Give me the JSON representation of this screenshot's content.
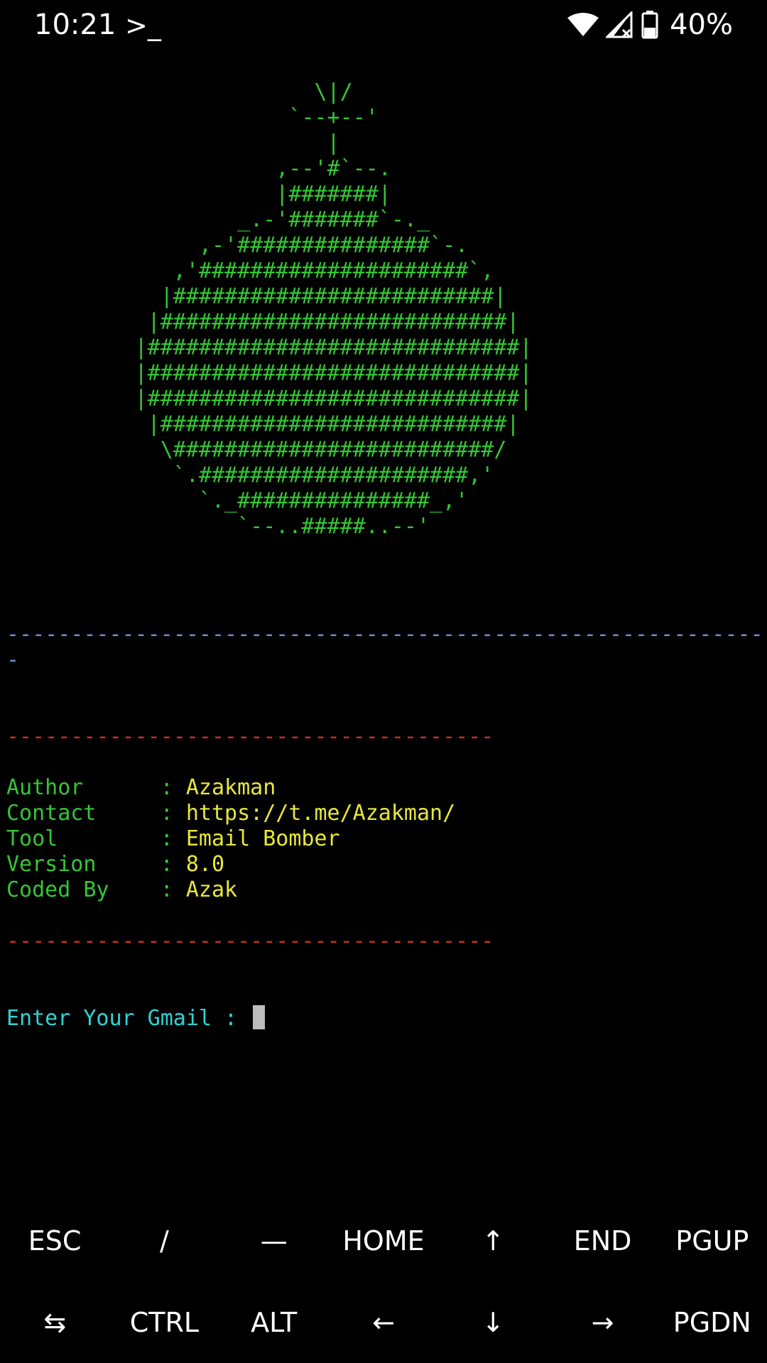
{
  "status_bar": {
    "time": "10:21",
    "app_icon": ">_",
    "battery": "40%",
    "icons": [
      "wifi-icon",
      "signal-off-icon",
      "battery-icon"
    ]
  },
  "terminal": {
    "ascii_art": "                        \\|/\n                      `--+--'\n                         |\n                     ,--'#`--.\n                     |#######|\n                  _.-'#######`-._\n               ,-'###############`-.\n             ,'#####################`,\n            |#########################|\n           |###########################|\n          |#############################|\n          |#############################|\n          |#############################|\n           |###########################|\n            \\#########################/\n             `.#####################,'\n               `._###############_,'\n                  `--..#####..--'",
    "separator_blue_1": "-----------------------------------------------------------",
    "separator_blue_2": "-",
    "separator_red": "--------------------------------------",
    "info": [
      {
        "label": "Author      ",
        "sep": ": ",
        "value": "Azakman"
      },
      {
        "label": "Contact     ",
        "sep": ": ",
        "value": "https://t.me/Azakman/"
      },
      {
        "label": "Tool        ",
        "sep": ": ",
        "value": "Email Bomber"
      },
      {
        "label": "Version     ",
        "sep": ": ",
        "value": "8.0"
      },
      {
        "label": "Coded By    ",
        "sep": ": ",
        "value": "Azak"
      }
    ],
    "prompt": "Enter Your Gmail : ",
    "input_value": ""
  },
  "extra_keys": {
    "row1": [
      "ESC",
      "/",
      "—",
      "HOME",
      "↑",
      "END",
      "PGUP"
    ],
    "row2": [
      "⇆",
      "CTRL",
      "ALT",
      "←",
      "↓",
      "→",
      "PGDN"
    ]
  },
  "colors": {
    "art": "#34c634",
    "label": "#34c634",
    "value": "#e8e83a",
    "prompt": "#2fd3d3",
    "separator_blue": "#6e8fd8",
    "separator_red": "#d42a2a"
  }
}
